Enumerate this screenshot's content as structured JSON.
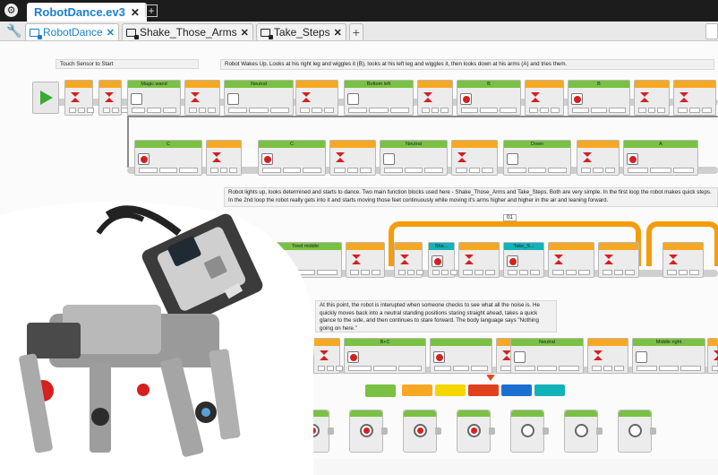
{
  "titlebar": {
    "project_name": "RobotDance.ev3",
    "close_symbol": "✕",
    "new_symbol": "+"
  },
  "program_tabs": {
    "items": [
      {
        "label": "RobotDance",
        "active": true
      },
      {
        "label": "Shake_Those_Arms",
        "active": false
      },
      {
        "label": "Take_Steps",
        "active": false
      }
    ],
    "close_symbol": "✕",
    "add_symbol": "+"
  },
  "comments": {
    "c1": "Touch Sensor to Start",
    "c2": "Robot Wakes Up. Looks at his right leg and wiggles it (B), looks at his left leg and wiggles it, then looks down at his arms (A) and tries them.",
    "c3": "Robot lights up, looks determined and starts to dance. Two main function blocks used here - Shake_Those_Arms and Take_Steps. Both are very simple. In the first loop the robot makes quick steps. In the 2nd loop the robot really gets into it and starts moving those feet continuously while moving it's arms higher and higher in the air and leaning forward.",
    "c4": "At this point, the robot is interupted when someone checks to see what all the noise is. He quickly moves back into a neutral standing positions staring straight ahead, takes a quick glance to the side, and then continues to stare forward. The body language says \"Nothing going on here.\""
  },
  "block_labels": {
    "magic_wand": "Magic wand",
    "neutral": "Neutral",
    "bottom_left": "Bottom left",
    "b": "B",
    "c": "C",
    "down": "Down",
    "a": "A",
    "tired_middle": "Tired middle",
    "loop_01": "01",
    "sha": "Sha...",
    "take_s": "Take_S...",
    "b_c": "B+C",
    "middle_right": "Middle right"
  },
  "palette_colors": [
    "#7ac143",
    "#f7a823",
    "#f4d600",
    "#e0411d",
    "#1c6fd1",
    "#12b3b8"
  ]
}
